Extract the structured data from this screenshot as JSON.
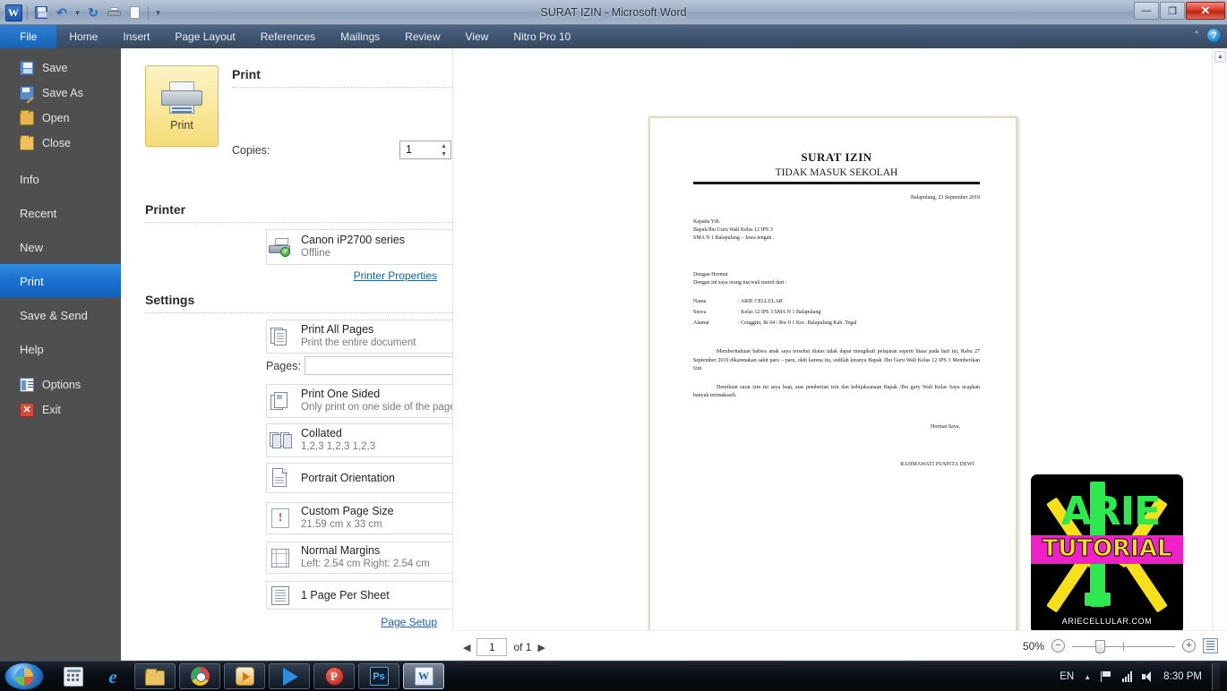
{
  "window": {
    "title": "SURAT IZIN  -  Microsoft Word",
    "minimize_label": "—",
    "restore_label": "❐",
    "close_label": "✕"
  },
  "quick_access": [
    {
      "name": "word-logo",
      "label": "W"
    },
    {
      "name": "save-icon",
      "label": ""
    },
    {
      "name": "undo-icon",
      "label": "↶"
    },
    {
      "name": "undo-dropdown-icon",
      "label": "▾"
    },
    {
      "name": "redo-icon",
      "label": "↻"
    },
    {
      "name": "quick-print-icon",
      "label": ""
    },
    {
      "name": "new-doc-icon",
      "label": ""
    },
    {
      "name": "customize-qat-icon",
      "label": "▾"
    }
  ],
  "ribbon": {
    "tabs": [
      {
        "label": "File",
        "selected": true
      },
      {
        "label": "Home",
        "selected": false
      },
      {
        "label": "Insert",
        "selected": false
      },
      {
        "label": "Page Layout",
        "selected": false
      },
      {
        "label": "References",
        "selected": false
      },
      {
        "label": "Mailings",
        "selected": false
      },
      {
        "label": "Review",
        "selected": false
      },
      {
        "label": "View",
        "selected": false
      },
      {
        "label": "Nitro Pro 10",
        "selected": false
      }
    ],
    "collapse_icon": "⌃",
    "help_label": "?"
  },
  "sidebar": {
    "items": [
      {
        "label": "Save",
        "icon": "save-icon"
      },
      {
        "label": "Save As",
        "icon": "save-as-icon"
      },
      {
        "label": "Open",
        "icon": "open-folder-icon"
      },
      {
        "label": "Close",
        "icon": "close-folder-icon"
      },
      {
        "label": "Info",
        "icon": ""
      },
      {
        "label": "Recent",
        "icon": ""
      },
      {
        "label": "New",
        "icon": ""
      },
      {
        "label": "Print",
        "icon": "",
        "selected": true
      },
      {
        "label": "Save & Send",
        "icon": ""
      },
      {
        "label": "Help",
        "icon": ""
      },
      {
        "label": "Options",
        "icon": "options-icon"
      },
      {
        "label": "Exit",
        "icon": "exit-icon"
      }
    ]
  },
  "print_pane": {
    "print_button_label": "Print",
    "heading": "Print",
    "copies_label": "Copies:",
    "copies_value": "1",
    "printer_heading": "Printer",
    "printer_name": "Canon iP2700 series",
    "printer_status": "Offline",
    "printer_properties_link": "Printer Properties",
    "settings_heading": "Settings",
    "pages_label": "Pages:",
    "pages_value": "",
    "page_setup_link": "Page Setup",
    "settings": [
      {
        "title": "Print All Pages",
        "subtitle": "Print the entire document",
        "icon": "pages-icon"
      },
      {
        "title": "Print One Sided",
        "subtitle": "Only print on one side of the page",
        "icon": "one-sided-icon"
      },
      {
        "title": "Collated",
        "subtitle": "1,2,3   1,2,3   1,2,3",
        "icon": "collated-icon"
      },
      {
        "title": "Portrait Orientation",
        "subtitle": "",
        "icon": "orientation-icon"
      },
      {
        "title": "Custom Page Size",
        "subtitle": "21.59 cm x 33 cm",
        "icon": "page-size-icon"
      },
      {
        "title": "Normal Margins",
        "subtitle": "Left:  2.54 cm    Right:  2.54 cm",
        "icon": "margins-icon"
      },
      {
        "title": "1 Page Per Sheet",
        "subtitle": "",
        "icon": "pages-per-sheet-icon"
      }
    ]
  },
  "document": {
    "title": "SURAT IZIN",
    "subtitle": "TIDAK MASUK SEKOLAH",
    "date_line": "Balapulang, 23 September 2019",
    "recipient": [
      "Kepada Yth.",
      "Bapak/Ibu Guru Wali Kelas 12 IPS 3",
      "SMA N 1 Balapulang – Jawa tengah"
    ],
    "salutation": [
      "Dengan Hormat",
      "Dengan ini saya orang tua/wali murid dari :"
    ],
    "fields": [
      {
        "key": "Nama",
        "value": ": ARIE CELLULAR"
      },
      {
        "key": "Siswa",
        "value": ": Kelas 12 IPS 3 SMA N 1 Balapulang"
      },
      {
        "key": "Alamat",
        "value": ": Cenggini, Rt 04 / Rw 0 1 Kec. Balapulang Kab. Tegal"
      }
    ],
    "paragraph1": "Memberitahuan bahwa anak saya tersebut diatas tidak dapat mengikuti pelajaran seperti biasa pada hari ini, Rabu 27 September 2019 dikarenakan sakit paru – paru, oleh karena itu, sudilah kiranya Bapak /Ibu Guru Wali Kelas 12 IPS 3 Memberikan Izin",
    "paragraph2": "Demikian surat izin ini saya buat, atas pemberian izin dan kebijaksanaan Bapak /Ibu gury Wali Kelas Saya ucapkan banyak terimakasih.",
    "closing": "Hormat Saya,",
    "signer": "RAHMAWATI PUSPITA DEWI"
  },
  "logo": {
    "brand": "ARIE",
    "tagline": "TUTORIAL",
    "url": "ARIECELLULAR.COM",
    "colors": {
      "brand": "#2ee84f",
      "tagline": "#f5e01a",
      "band": "#f020c8",
      "frame": "#f5e01a"
    }
  },
  "status_bar": {
    "prev_icon": "◀",
    "next_icon": "▶",
    "page_value": "1",
    "of_label": "of 1",
    "zoom_percent": "50%",
    "zoom_out_label": "−",
    "zoom_in_label": "+"
  },
  "scrollbar": {
    "up_icon": "▲"
  },
  "taskbar": {
    "start_label": "",
    "items": [
      {
        "name": "calculator-icon",
        "active": false,
        "plain": true
      },
      {
        "name": "internet-explorer-icon",
        "active": false,
        "plain": true
      },
      {
        "name": "file-explorer-icon",
        "active": false,
        "plain": false
      },
      {
        "name": "chrome-icon",
        "active": false,
        "plain": false
      },
      {
        "name": "media-player-icon",
        "active": false,
        "plain": false
      },
      {
        "name": "video-player-icon",
        "active": false,
        "plain": false
      },
      {
        "name": "powerdirector-icon",
        "active": false,
        "plain": false
      },
      {
        "name": "photoshop-icon",
        "active": false,
        "plain": false
      },
      {
        "name": "word-taskbar-icon",
        "active": true,
        "plain": false
      }
    ],
    "tray": {
      "language": "EN",
      "show_hidden_icon": "▲",
      "time": "8:30 PM"
    }
  }
}
